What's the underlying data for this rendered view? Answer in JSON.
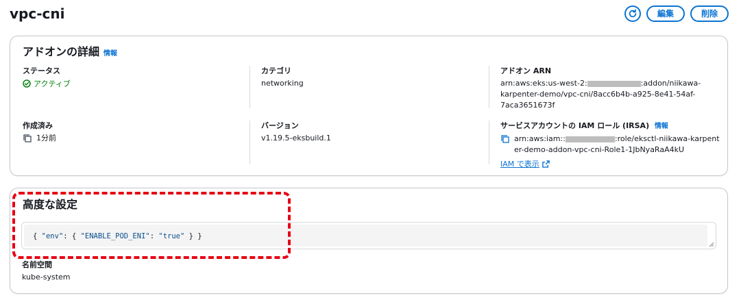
{
  "header": {
    "title": "vpc-cni",
    "edit_label": "編集",
    "delete_label": "削除",
    "refresh_icon": "refresh-icon"
  },
  "details": {
    "heading": "アドオンの詳細",
    "info": "情報",
    "status_label": "ステータス",
    "status_value": "アクティブ",
    "category_label": "カテゴリ",
    "category_value": "networking",
    "arn_label": "アドオン ARN",
    "arn_prefix": "arn:aws:eks:us-west-2:",
    "arn_line1_suffix": ":addon/niikawa-",
    "arn_line2": "karpenter-demo/vpc-cni/8acc6b4b-a925-8e41-54af-",
    "arn_line3": "7aca3651673f",
    "created_label": "作成済み",
    "created_value": "1分前",
    "version_label": "バージョン",
    "version_value": "v1.19.5-eksbuild.1",
    "irsa_label": "サービスアカウントの IAM ロール (IRSA)",
    "irsa_info": "情報",
    "irsa_prefix": "arn:aws:iam::",
    "irsa_line1_suffix": ":role/eksctl-niikawa-karpent",
    "irsa_line2": "er-demo-addon-vpc-cni-Role1-1JbNyaRaA4kU",
    "iam_view_link": "IAM で表示"
  },
  "advanced": {
    "heading": "高度な設定",
    "config_open": "{ ",
    "config_key1": "\"env\"",
    "config_mid": ": { ",
    "config_key2": "\"ENABLE_POD_ENI\"",
    "config_colon": ": ",
    "config_val": "\"true\"",
    "config_close": " } }",
    "namespace_label": "名前空間",
    "namespace_value": "kube-system"
  },
  "colors": {
    "accent": "#0972d3",
    "success": "#037f0c",
    "highlight": "#e60012"
  }
}
